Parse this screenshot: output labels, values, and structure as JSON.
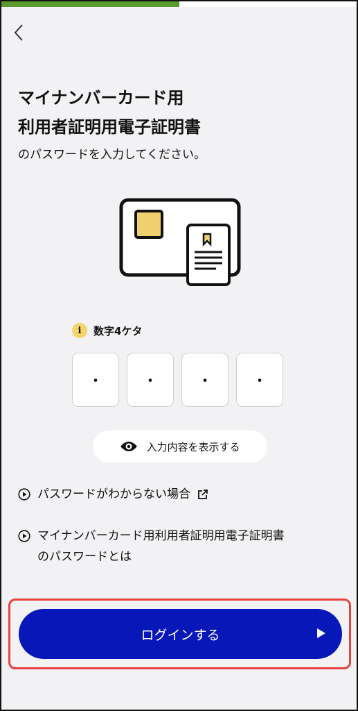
{
  "progress": {
    "value": 0.5
  },
  "nav": {
    "back_icon": "chevron-left-icon"
  },
  "title": {
    "line1": "マイナンバーカード用",
    "line2": "利用者証明用電子証明書"
  },
  "subtitle": "のパスワードを入力してください。",
  "pin": {
    "hint_icon": "info-icon",
    "hint_label": "数字4ケタ",
    "digits": [
      "・",
      "・",
      "・",
      "・"
    ]
  },
  "show_toggle": {
    "icon": "eye-icon",
    "label": "入力内容を表示する"
  },
  "links": [
    {
      "icon": "play-circle-icon",
      "label": "パスワードがわからない場合",
      "trailing_icon": "external-link-icon"
    },
    {
      "icon": "play-circle-icon",
      "label_line1": "マイナンバーカード用利用者証明用電子証明書",
      "label_line2": "のパスワードとは"
    }
  ],
  "login": {
    "label": "ログインする",
    "icon": "play-arrow-icon"
  },
  "colors": {
    "accent": "#0717b8",
    "progress": "#5a9a2e",
    "highlight": "#e8413e",
    "chip": "#f2d66b"
  }
}
